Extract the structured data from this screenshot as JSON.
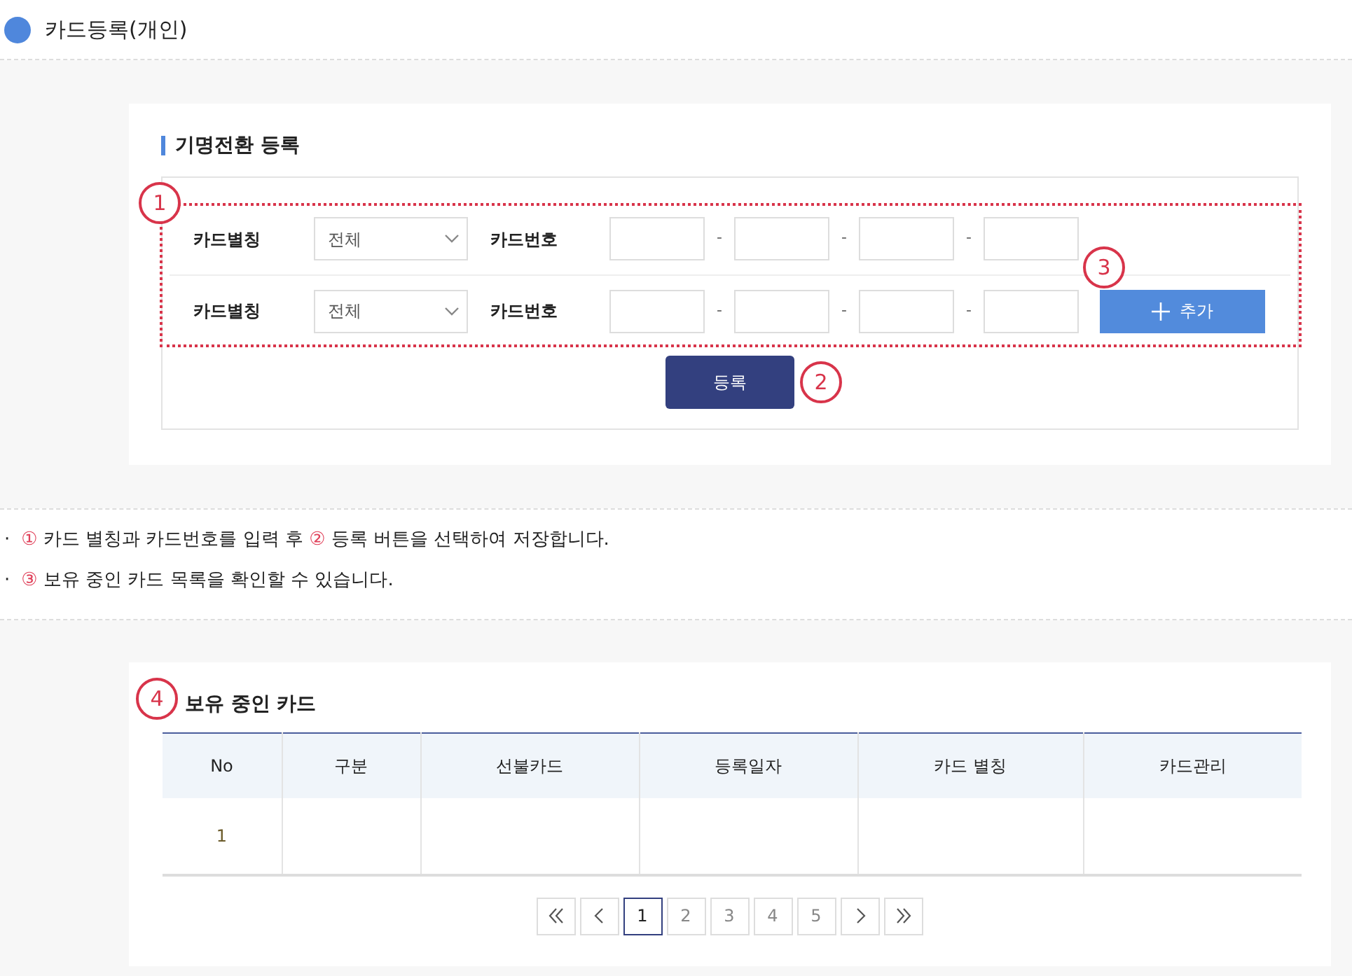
{
  "page_title": "카드등록(개인)",
  "form": {
    "title": "기명전환 등록",
    "rows": [
      {
        "alias_label": "카드별칭",
        "alias_select": "전체",
        "number_label": "카드번호",
        "separators": [
          "-",
          "-",
          "-"
        ]
      },
      {
        "alias_label": "카드별칭",
        "alias_select": "전체",
        "number_label": "카드번호",
        "separators": [
          "-",
          "-",
          "-"
        ]
      }
    ],
    "add_button": "추가",
    "submit_button": "등록"
  },
  "callouts": [
    "1",
    "2",
    "3",
    "4"
  ],
  "notes": [
    {
      "bullet": "·",
      "parts": [
        {
          "kind": "marker",
          "text": "①"
        },
        {
          "kind": "text",
          "text": "카드 별칭과 카드번호를 입력 후"
        },
        {
          "kind": "marker",
          "text": "②"
        },
        {
          "kind": "text",
          "text": "등록 버튼을 선택하여 저장합니다."
        }
      ]
    },
    {
      "bullet": "·",
      "parts": [
        {
          "kind": "marker",
          "text": "③"
        },
        {
          "kind": "text",
          "text": "보유 중인 카드 목록을 확인할 수 있습니다."
        }
      ]
    }
  ],
  "cards": {
    "title": "보유 중인 카드",
    "table": {
      "columns": [
        "No",
        "구분",
        "선불카드",
        "등록일자",
        "카드 별칭",
        "카드관리"
      ],
      "rows": [
        [
          "1",
          "",
          "",
          "",
          "",
          ""
        ]
      ]
    },
    "pagination": {
      "pages": [
        {
          "label": "1",
          "selected": true
        },
        {
          "label": "2",
          "selected": false
        },
        {
          "label": "3",
          "selected": false
        },
        {
          "label": "4",
          "selected": false
        },
        {
          "label": "5",
          "selected": false
        }
      ]
    }
  }
}
